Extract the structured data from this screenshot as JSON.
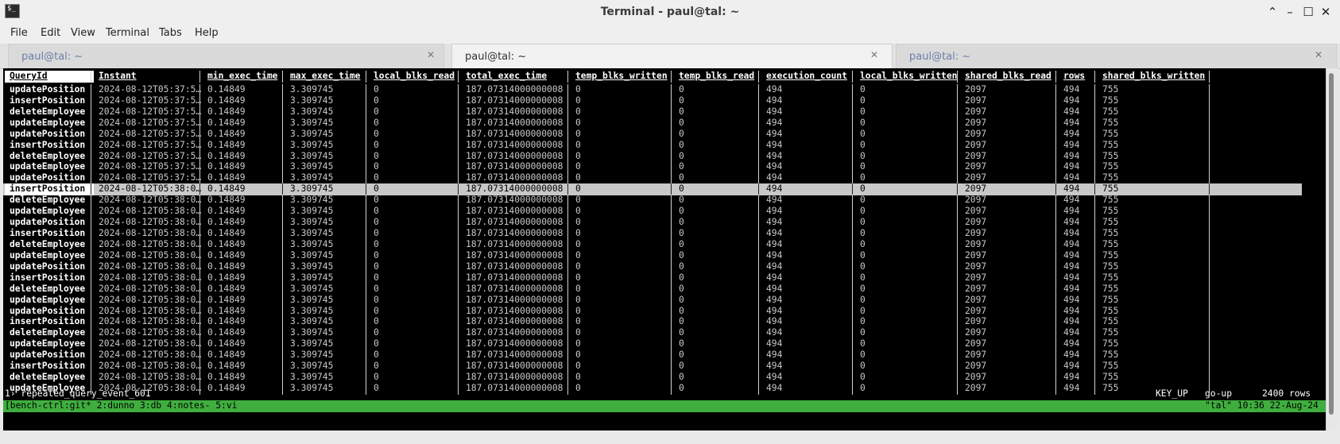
{
  "window": {
    "title": "Terminal - paul@tal: ~",
    "icon": "terminal-icon",
    "controls": [
      "chevron-up-icon",
      "minimize-icon",
      "maximize-icon",
      "close-icon"
    ]
  },
  "menu": [
    "File",
    "Edit",
    "View",
    "Terminal",
    "Tabs",
    "Help"
  ],
  "tabs": [
    {
      "label": "paul@tal: ~",
      "active": false
    },
    {
      "label": "paul@tal: ~",
      "active": true
    },
    {
      "label": "paul@tal: ~",
      "active": false
    }
  ],
  "table": {
    "columns": [
      "QueryId",
      "Instant",
      "min_exec_time",
      "max_exec_time",
      "local_blks_read",
      "total_exec_time",
      "temp_blks_written",
      "temp_blks_read",
      "execution_count",
      "local_blks_written",
      "shared_blks_read",
      "rows",
      "shared_blks_written"
    ],
    "selected_row_index": 9,
    "rows": [
      [
        "updatePosition",
        "2024-08-12T05:37:5…",
        "0.14849",
        "3.309745",
        "0",
        "187.07314000000008",
        "0",
        "0",
        "494",
        "0",
        "2097",
        "494",
        "755"
      ],
      [
        "insertPosition",
        "2024-08-12T05:37:5…",
        "0.14849",
        "3.309745",
        "0",
        "187.07314000000008",
        "0",
        "0",
        "494",
        "0",
        "2097",
        "494",
        "755"
      ],
      [
        "deleteEmployee",
        "2024-08-12T05:37:5…",
        "0.14849",
        "3.309745",
        "0",
        "187.07314000000008",
        "0",
        "0",
        "494",
        "0",
        "2097",
        "494",
        "755"
      ],
      [
        "updateEmployee",
        "2024-08-12T05:37:5…",
        "0.14849",
        "3.309745",
        "0",
        "187.07314000000008",
        "0",
        "0",
        "494",
        "0",
        "2097",
        "494",
        "755"
      ],
      [
        "updatePosition",
        "2024-08-12T05:37:5…",
        "0.14849",
        "3.309745",
        "0",
        "187.07314000000008",
        "0",
        "0",
        "494",
        "0",
        "2097",
        "494",
        "755"
      ],
      [
        "insertPosition",
        "2024-08-12T05:37:5…",
        "0.14849",
        "3.309745",
        "0",
        "187.07314000000008",
        "0",
        "0",
        "494",
        "0",
        "2097",
        "494",
        "755"
      ],
      [
        "deleteEmployee",
        "2024-08-12T05:37:5…",
        "0.14849",
        "3.309745",
        "0",
        "187.07314000000008",
        "0",
        "0",
        "494",
        "0",
        "2097",
        "494",
        "755"
      ],
      [
        "updateEmployee",
        "2024-08-12T05:37:5…",
        "0.14849",
        "3.309745",
        "0",
        "187.07314000000008",
        "0",
        "0",
        "494",
        "0",
        "2097",
        "494",
        "755"
      ],
      [
        "updatePosition",
        "2024-08-12T05:37:5…",
        "0.14849",
        "3.309745",
        "0",
        "187.07314000000008",
        "0",
        "0",
        "494",
        "0",
        "2097",
        "494",
        "755"
      ],
      [
        "insertPosition",
        "2024-08-12T05:38:0…",
        "0.14849",
        "3.309745",
        "0",
        "187.07314000000008",
        "0",
        "0",
        "494",
        "0",
        "2097",
        "494",
        "755"
      ],
      [
        "deleteEmployee",
        "2024-08-12T05:38:0…",
        "0.14849",
        "3.309745",
        "0",
        "187.07314000000008",
        "0",
        "0",
        "494",
        "0",
        "2097",
        "494",
        "755"
      ],
      [
        "updateEmployee",
        "2024-08-12T05:38:0…",
        "0.14849",
        "3.309745",
        "0",
        "187.07314000000008",
        "0",
        "0",
        "494",
        "0",
        "2097",
        "494",
        "755"
      ],
      [
        "updatePosition",
        "2024-08-12T05:38:0…",
        "0.14849",
        "3.309745",
        "0",
        "187.07314000000008",
        "0",
        "0",
        "494",
        "0",
        "2097",
        "494",
        "755"
      ],
      [
        "insertPosition",
        "2024-08-12T05:38:0…",
        "0.14849",
        "3.309745",
        "0",
        "187.07314000000008",
        "0",
        "0",
        "494",
        "0",
        "2097",
        "494",
        "755"
      ],
      [
        "deleteEmployee",
        "2024-08-12T05:38:0…",
        "0.14849",
        "3.309745",
        "0",
        "187.07314000000008",
        "0",
        "0",
        "494",
        "0",
        "2097",
        "494",
        "755"
      ],
      [
        "updateEmployee",
        "2024-08-12T05:38:0…",
        "0.14849",
        "3.309745",
        "0",
        "187.07314000000008",
        "0",
        "0",
        "494",
        "0",
        "2097",
        "494",
        "755"
      ],
      [
        "updatePosition",
        "2024-08-12T05:38:0…",
        "0.14849",
        "3.309745",
        "0",
        "187.07314000000008",
        "0",
        "0",
        "494",
        "0",
        "2097",
        "494",
        "755"
      ],
      [
        "insertPosition",
        "2024-08-12T05:38:0…",
        "0.14849",
        "3.309745",
        "0",
        "187.07314000000008",
        "0",
        "0",
        "494",
        "0",
        "2097",
        "494",
        "755"
      ],
      [
        "deleteEmployee",
        "2024-08-12T05:38:0…",
        "0.14849",
        "3.309745",
        "0",
        "187.07314000000008",
        "0",
        "0",
        "494",
        "0",
        "2097",
        "494",
        "755"
      ],
      [
        "updateEmployee",
        "2024-08-12T05:38:0…",
        "0.14849",
        "3.309745",
        "0",
        "187.07314000000008",
        "0",
        "0",
        "494",
        "0",
        "2097",
        "494",
        "755"
      ],
      [
        "updatePosition",
        "2024-08-12T05:38:0…",
        "0.14849",
        "3.309745",
        "0",
        "187.07314000000008",
        "0",
        "0",
        "494",
        "0",
        "2097",
        "494",
        "755"
      ],
      [
        "insertPosition",
        "2024-08-12T05:38:0…",
        "0.14849",
        "3.309745",
        "0",
        "187.07314000000008",
        "0",
        "0",
        "494",
        "0",
        "2097",
        "494",
        "755"
      ],
      [
        "deleteEmployee",
        "2024-08-12T05:38:0…",
        "0.14849",
        "3.309745",
        "0",
        "187.07314000000008",
        "0",
        "0",
        "494",
        "0",
        "2097",
        "494",
        "755"
      ],
      [
        "updateEmployee",
        "2024-08-12T05:38:0…",
        "0.14849",
        "3.309745",
        "0",
        "187.07314000000008",
        "0",
        "0",
        "494",
        "0",
        "2097",
        "494",
        "755"
      ],
      [
        "updatePosition",
        "2024-08-12T05:38:0…",
        "0.14849",
        "3.309745",
        "0",
        "187.07314000000008",
        "0",
        "0",
        "494",
        "0",
        "2097",
        "494",
        "755"
      ],
      [
        "insertPosition",
        "2024-08-12T05:38:0…",
        "0.14849",
        "3.309745",
        "0",
        "187.07314000000008",
        "0",
        "0",
        "494",
        "0",
        "2097",
        "494",
        "755"
      ],
      [
        "deleteEmployee",
        "2024-08-12T05:38:0…",
        "0.14849",
        "3.309745",
        "0",
        "187.07314000000008",
        "0",
        "0",
        "494",
        "0",
        "2097",
        "494",
        "755"
      ],
      [
        "updateEmployee",
        "2024-08-12T05:38:0…",
        "0.14849",
        "3.309745",
        "0",
        "187.07314000000008",
        "0",
        "0",
        "494",
        "0",
        "2097",
        "494",
        "755"
      ]
    ]
  },
  "prompt": {
    "text": "1› repeated_query_event_601",
    "key": "KEY_UP",
    "action": "go-up",
    "row_count": "2400 rows"
  },
  "tmux": {
    "left": "[bench-ctrl:git* 2:dunno  3:db  4:notes- 5:vi",
    "right": "\"tal\" 10:36 22-Aug-24"
  },
  "colors": {
    "terminal_bg": "#000000",
    "status_bar": "#3fae3f",
    "selected_row": "#c8c8c8"
  }
}
